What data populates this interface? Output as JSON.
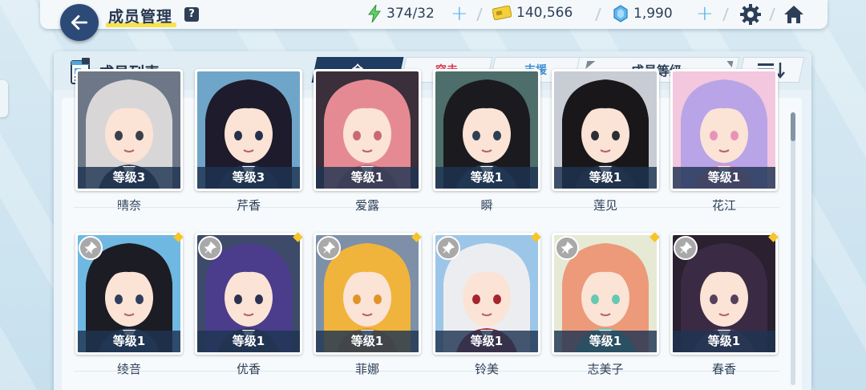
{
  "header": {
    "title": "成员管理",
    "help_label": "?",
    "stamina": "374/32",
    "credits": "140,566",
    "gems": "1,990",
    "plus": "+"
  },
  "panel": {
    "title": "成员列表",
    "tabs": [
      {
        "label": "全",
        "active": true
      },
      {
        "label": "突击",
        "active": false
      },
      {
        "label": "支援",
        "active": false
      }
    ],
    "sort_label": "成员等级"
  },
  "members": [
    {
      "name": "晴奈",
      "level": "等级3",
      "hair": "#d9d6d8",
      "bg": "#6d7787",
      "accent": "#3b3f4a"
    },
    {
      "name": "芹香",
      "level": "等级3",
      "hair": "#1d1b2c",
      "bg": "#6fa5c8",
      "accent": "#27304a"
    },
    {
      "name": "爱露",
      "level": "等级1",
      "hair": "#e58a93",
      "bg": "#3a2f3a",
      "accent": "#c86a72"
    },
    {
      "name": "瞬",
      "level": "等级1",
      "hair": "#1a1a1f",
      "bg": "#4d6e6a",
      "accent": "#2e3f52"
    },
    {
      "name": "莲见",
      "level": "等级1",
      "hair": "#191719",
      "bg": "#c8ccd4",
      "accent": "#2d2d35"
    },
    {
      "name": "花江",
      "level": "等级1",
      "hair": "#b8a4e6",
      "bg": "#f3c7dd",
      "accent": "#e992b8"
    },
    {
      "name": "绫音",
      "level": "等级1",
      "hair": "#1c1c24",
      "bg": "#6fb8e2",
      "accent": "#2f3e5c"
    },
    {
      "name": "优香",
      "level": "等级1",
      "hair": "#4b3c8c",
      "bg": "#3d4a6a",
      "accent": "#2c3250"
    },
    {
      "name": "菲娜",
      "level": "等级1",
      "hair": "#f0b43c",
      "bg": "#7e90a8",
      "accent": "#e1932a"
    },
    {
      "name": "铃美",
      "level": "等级1",
      "hair": "#ecedf1",
      "bg": "#9bc6e8",
      "accent": "#a5262e"
    },
    {
      "name": "志美子",
      "level": "等级1",
      "hair": "#ec9a7a",
      "bg": "#e6e9d4",
      "accent": "#67c8b2"
    },
    {
      "name": "春香",
      "level": "等级1",
      "hair": "#3a2a44",
      "bg": "#2a2030",
      "accent": "#56405c"
    }
  ],
  "colors": {
    "navy": "#1f3d63",
    "assault": "#e0394b",
    "support": "#3f8ed3",
    "gold": "#f5c52a"
  }
}
